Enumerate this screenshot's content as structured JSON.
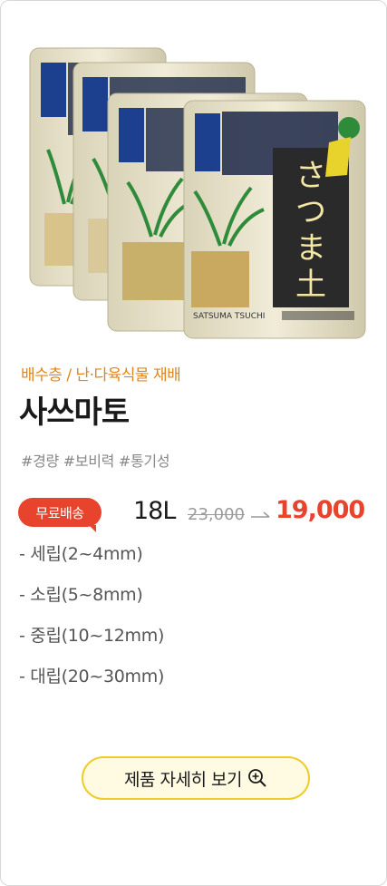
{
  "product": {
    "category": "배수층 / 난·다육식물 재배",
    "title": "사쓰마토",
    "tags": "#경량 #보비력 #통기성",
    "image_icon": "soil-bags-image",
    "bag_label": "SATSUMA TSUCHI",
    "bag_brand": "さつま土"
  },
  "pricing": {
    "badge": "무료배송",
    "volume": "18L",
    "old_price": "23,000",
    "new_price": "19,000",
    "accent_color": "#e8432d"
  },
  "sizes": [
    "- 세립(2~4mm)",
    "- 소립(5~8mm)",
    "- 중립(10~12mm)",
    "- 대립(20~30mm)"
  ],
  "button": {
    "label": "제품 자세히 보기",
    "icon": "zoom-in-icon"
  }
}
